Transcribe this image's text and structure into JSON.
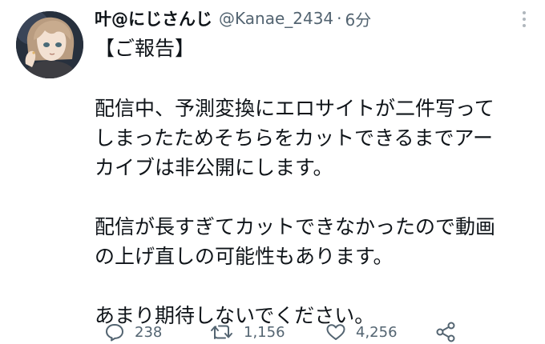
{
  "author": {
    "display_name": "叶@にじさんじ",
    "handle": "@Kanae_2434",
    "separator": "·",
    "time": "6分"
  },
  "icons": {
    "more": "more-dots-icon",
    "reply": "reply-bubble-icon",
    "retweet": "retweet-arrows-icon",
    "like": "heart-icon",
    "share": "share-nodes-icon"
  },
  "tweet": {
    "line1": "【ご報告】",
    "para1": "配信中、予測変換にエロサイトが二件写って\nしまったためそちらをカットできるまでアー\nカイブは非公開にします。",
    "para2": "配信が長すぎてカットできなかったので動画\nの上げ直しの可能性もあります。",
    "para3": "あまり期待しないでください。"
  },
  "stats": {
    "replies": "238",
    "retweets": "1,156",
    "likes": "4,256"
  },
  "colors": {
    "text": "#0f1419",
    "muted": "#536471",
    "background": "#ffffff"
  }
}
